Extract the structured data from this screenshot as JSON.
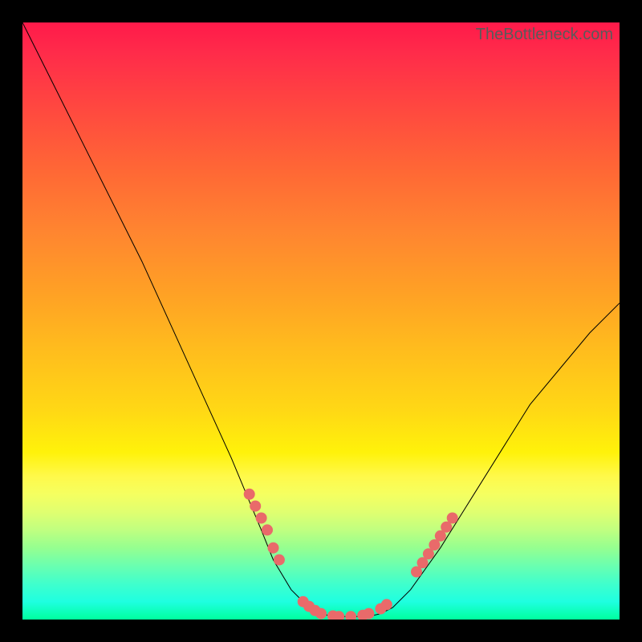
{
  "watermark": "TheBottleneck.com",
  "chart_data": {
    "type": "line",
    "title": "",
    "xlabel": "",
    "ylabel": "",
    "xlim": [
      0,
      100
    ],
    "ylim": [
      0,
      100
    ],
    "series": [
      {
        "name": "curve",
        "x": [
          0,
          5,
          10,
          15,
          20,
          25,
          30,
          35,
          40,
          42,
          45,
          48,
          50,
          52,
          55,
          58,
          60,
          62,
          65,
          70,
          75,
          80,
          85,
          90,
          95,
          100
        ],
        "y": [
          100,
          90,
          80,
          70,
          60,
          49,
          38,
          27,
          15,
          10,
          5,
          2,
          1,
          0.5,
          0.5,
          0.5,
          1,
          2,
          5,
          12,
          20,
          28,
          36,
          42,
          48,
          53
        ]
      }
    ],
    "markers": {
      "name": "dots",
      "color": "#e96a6a",
      "points": [
        {
          "x": 38,
          "y": 21
        },
        {
          "x": 39,
          "y": 19
        },
        {
          "x": 40,
          "y": 17
        },
        {
          "x": 41,
          "y": 15
        },
        {
          "x": 42,
          "y": 12
        },
        {
          "x": 43,
          "y": 10
        },
        {
          "x": 47,
          "y": 3
        },
        {
          "x": 48,
          "y": 2.2
        },
        {
          "x": 49,
          "y": 1.5
        },
        {
          "x": 50,
          "y": 1
        },
        {
          "x": 52,
          "y": 0.6
        },
        {
          "x": 53,
          "y": 0.5
        },
        {
          "x": 55,
          "y": 0.5
        },
        {
          "x": 57,
          "y": 0.7
        },
        {
          "x": 58,
          "y": 1
        },
        {
          "x": 60,
          "y": 1.8
        },
        {
          "x": 61,
          "y": 2.5
        },
        {
          "x": 66,
          "y": 8
        },
        {
          "x": 67,
          "y": 9.5
        },
        {
          "x": 68,
          "y": 11
        },
        {
          "x": 69,
          "y": 12.5
        },
        {
          "x": 70,
          "y": 14
        },
        {
          "x": 71,
          "y": 15.5
        },
        {
          "x": 72,
          "y": 17
        }
      ]
    },
    "background": "vertical-gradient-red-to-green"
  }
}
